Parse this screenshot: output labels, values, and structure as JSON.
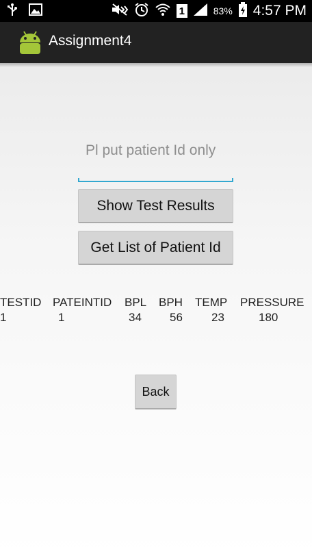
{
  "status_bar": {
    "battery_percent": "83%",
    "time": "4:57 PM",
    "sim_badge": "1",
    "left_icons": [
      "usb-icon",
      "image-icon"
    ],
    "right_icons": [
      "mute-icon",
      "alarm-icon",
      "wifi-icon",
      "sim-icon",
      "signal-icon",
      "battery-icon"
    ]
  },
  "action_bar": {
    "title": "Assignment4",
    "icon": "android-icon"
  },
  "form": {
    "patient_id_placeholder": "Pl put patient Id only",
    "show_results_label": "Show Test Results",
    "list_patients_label": "Get List of Patient Id",
    "back_label": "Back"
  },
  "results": {
    "headers": [
      "TESTID",
      "PATEINTID",
      "BPL",
      "BPH",
      "TEMP",
      "PRESSURE"
    ],
    "rows": [
      [
        "1",
        "1",
        "34",
        "56",
        "23",
        "180"
      ]
    ]
  },
  "colors": {
    "accent": "#33a8d0",
    "action_bar_bg": "#222222",
    "status_bar_bg": "#000000",
    "button_bg": "#d5d5d5"
  }
}
